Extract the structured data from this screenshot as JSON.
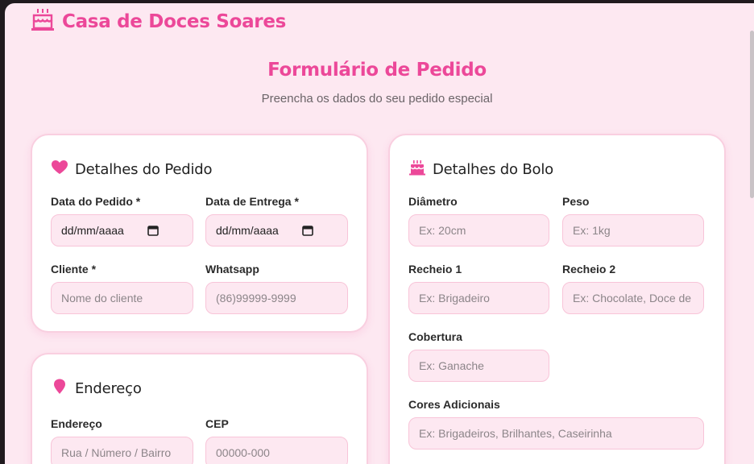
{
  "brand": {
    "name": "Casa de Doces Soares",
    "icon": "cake-icon"
  },
  "form": {
    "title": "Formulário de Pedido",
    "subtitle": "Preencha os dados do seu pedido especial"
  },
  "pedido": {
    "heading": "Detalhes do Pedido",
    "icon": "heart-icon",
    "data_pedido": {
      "label": "Data do Pedido *",
      "value": "dd/mm/aaaa"
    },
    "data_entrega": {
      "label": "Data de Entrega *",
      "value": "dd/mm/aaaa"
    },
    "cliente": {
      "label": "Cliente *",
      "placeholder": "Nome do cliente"
    },
    "whatsapp": {
      "label": "Whatsapp",
      "placeholder": "(86)99999-9999"
    }
  },
  "endereco": {
    "heading": "Endereço",
    "icon": "map-pin-icon",
    "endereco": {
      "label": "Endereço",
      "placeholder": "Rua / Número / Bairro"
    },
    "cep": {
      "label": "CEP",
      "placeholder": "00000-000"
    }
  },
  "bolo": {
    "heading": "Detalhes do Bolo",
    "icon": "cake-icon",
    "diametro": {
      "label": "Diâmetro",
      "placeholder": "Ex: 20cm"
    },
    "peso": {
      "label": "Peso",
      "placeholder": "Ex: 1kg"
    },
    "recheio1": {
      "label": "Recheio 1",
      "placeholder": "Ex: Brigadeiro"
    },
    "recheio2": {
      "label": "Recheio 2",
      "placeholder": "Ex: Chocolate, Doce de l"
    },
    "cobertura": {
      "label": "Cobertura",
      "placeholder": "Ex: Ganache"
    },
    "cores": {
      "label": "Cores Adicionais",
      "placeholder": "Ex: Brigadeiros, Brilhantes, Caseirinha"
    }
  },
  "colors": {
    "accent": "#ec4899",
    "background": "#fde8f1",
    "field_bg": "#fde8f1",
    "field_border": "#f8c4d8"
  }
}
